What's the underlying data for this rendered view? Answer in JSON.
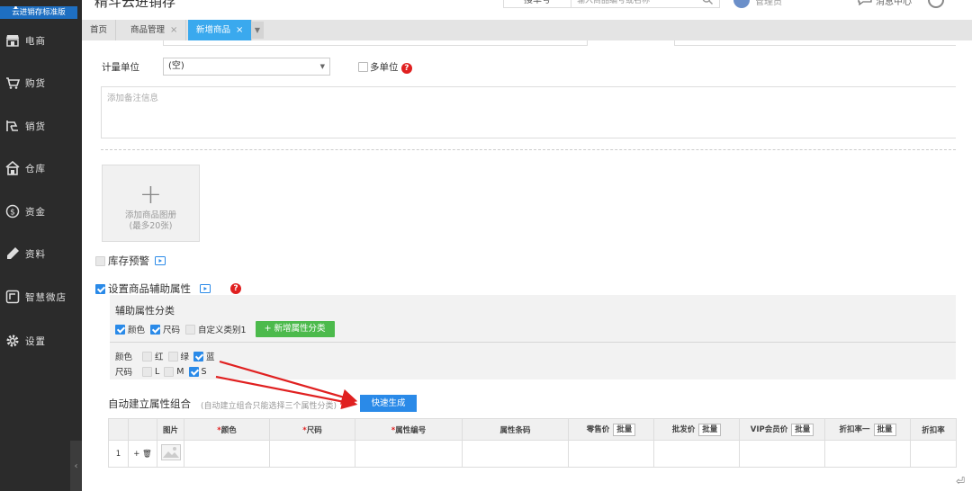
{
  "sidebar": {
    "edition": "云进销存标准版",
    "items": [
      {
        "label": "电商",
        "icon": "store-icon"
      },
      {
        "label": "购货",
        "icon": "cart-icon"
      },
      {
        "label": "销货",
        "icon": "sales-icon"
      },
      {
        "label": "仓库",
        "icon": "warehouse-icon"
      },
      {
        "label": "资金",
        "icon": "money-icon"
      },
      {
        "label": "资料",
        "icon": "pencil-icon"
      },
      {
        "label": "智慧微店",
        "icon": "shop-icon"
      },
      {
        "label": "设置",
        "icon": "gear-icon"
      }
    ],
    "collapse_glyph": "‹"
  },
  "topbar": {
    "title": "精斗云进销存",
    "search_scope": "搜单号",
    "search_placeholder": "输入商品编号或名称",
    "user_name": "管理员",
    "messages": "消息中心"
  },
  "tabs": [
    {
      "label": "首页",
      "closable": false,
      "active": false
    },
    {
      "label": "商品管理",
      "closable": true,
      "active": false
    },
    {
      "label": "新增商品",
      "closable": true,
      "active": true
    }
  ],
  "tab_close": "×",
  "tab_more": "▼",
  "form": {
    "unit_label": "计量单位",
    "unit_value": "(空)",
    "unit_caret": "▼",
    "multi_unit_label": "多单位",
    "help_glyph": "?",
    "remark_placeholder": "添加备注信息",
    "upload_plus": "+",
    "upload_label": "添加商品图册",
    "upload_sub": "(最多20张)",
    "stock_warning_label": "库存预警",
    "aux_attr_label": "设置商品辅助属性"
  },
  "aux": {
    "title": "辅助属性分类",
    "categories": [
      {
        "label": "颜色",
        "checked": true
      },
      {
        "label": "尺码",
        "checked": true
      },
      {
        "label": "自定义类别1",
        "checked": false
      }
    ],
    "add_button": "+ 新增属性分类",
    "color_label": "颜色",
    "colors": [
      {
        "label": "红",
        "checked": false
      },
      {
        "label": "绿",
        "checked": false
      },
      {
        "label": "蓝",
        "checked": true
      }
    ],
    "size_label": "尺码",
    "sizes": [
      {
        "label": "L",
        "checked": false
      },
      {
        "label": "M",
        "checked": false
      },
      {
        "label": "S",
        "checked": true
      }
    ]
  },
  "combo": {
    "label": "自动建立属性组合",
    "hint": "(自动建立组合只能选择三个属性分类)",
    "quick_button": "快速生成"
  },
  "table": {
    "headers": {
      "image": "图片",
      "color": "颜色",
      "size": "尺码",
      "code": "属性编号",
      "barcode": "属性条码",
      "retail": "零售价",
      "wholesale": "批发价",
      "vip": "VIP会员价",
      "discount1": "折扣率一",
      "discount2": "折扣率"
    },
    "required_mark": "*",
    "batch_label": "批量",
    "row_index": "1",
    "row_actions": "+ 🗑"
  },
  "corner_glyph": "⏎",
  "colors": {
    "sidebar_bg": "#2b2b2b",
    "accent_blue": "#2a8ae8",
    "tab_active": "#3aa9ee",
    "add_green": "#4cba4c",
    "arrow_red": "#e02020"
  }
}
